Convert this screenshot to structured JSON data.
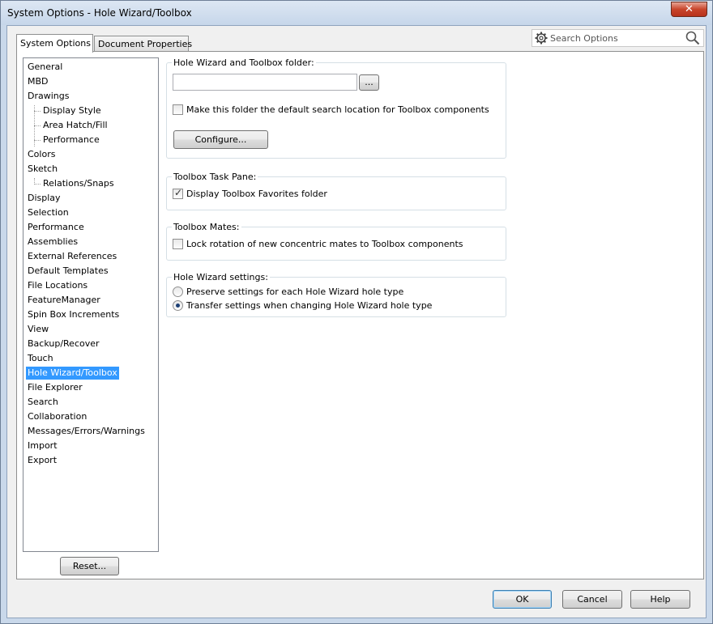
{
  "window": {
    "title": "System Options - Hole Wizard/Toolbox",
    "close_glyph": "✕"
  },
  "tabs": [
    {
      "label": "System Options",
      "active": true
    },
    {
      "label": "Document Properties",
      "active": false
    }
  ],
  "search": {
    "placeholder": "Search Options"
  },
  "tree": {
    "items": [
      {
        "label": "General",
        "level": 0
      },
      {
        "label": "MBD",
        "level": 0
      },
      {
        "label": "Drawings",
        "level": 0
      },
      {
        "label": "Display Style",
        "level": 1
      },
      {
        "label": "Area Hatch/Fill",
        "level": 1
      },
      {
        "label": "Performance",
        "level": 1
      },
      {
        "label": "Colors",
        "level": 0
      },
      {
        "label": "Sketch",
        "level": 0
      },
      {
        "label": "Relations/Snaps",
        "level": 1
      },
      {
        "label": "Display",
        "level": 0
      },
      {
        "label": "Selection",
        "level": 0
      },
      {
        "label": "Performance",
        "level": 0
      },
      {
        "label": "Assemblies",
        "level": 0
      },
      {
        "label": "External References",
        "level": 0
      },
      {
        "label": "Default Templates",
        "level": 0
      },
      {
        "label": "File Locations",
        "level": 0
      },
      {
        "label": "FeatureManager",
        "level": 0
      },
      {
        "label": "Spin Box Increments",
        "level": 0
      },
      {
        "label": "View",
        "level": 0
      },
      {
        "label": "Backup/Recover",
        "level": 0
      },
      {
        "label": "Touch",
        "level": 0
      },
      {
        "label": "Hole Wizard/Toolbox",
        "level": 0,
        "selected": true
      },
      {
        "label": "File Explorer",
        "level": 0
      },
      {
        "label": "Search",
        "level": 0
      },
      {
        "label": "Collaboration",
        "level": 0
      },
      {
        "label": "Messages/Errors/Warnings",
        "level": 0
      },
      {
        "label": "Import",
        "level": 0
      },
      {
        "label": "Export",
        "level": 0
      }
    ]
  },
  "reset_label": "Reset...",
  "folder_group": {
    "title": "Hole Wizard and Toolbox folder:",
    "path_value": "",
    "browse_label": "...",
    "default_location_label": "Make this folder the default search location for Toolbox components",
    "default_location_checked": false,
    "configure_label": "Configure..."
  },
  "task_pane_group": {
    "title": "Toolbox Task Pane:",
    "favorites_label": "Display Toolbox Favorites folder",
    "favorites_checked": true,
    "check_glyph": "✓"
  },
  "mates_group": {
    "title": "Toolbox Mates:",
    "lock_rotation_label": "Lock rotation of new concentric mates to Toolbox components",
    "lock_rotation_checked": false
  },
  "hole_wizard_group": {
    "title": "Hole Wizard settings:",
    "options": [
      {
        "label": "Preserve settings for each Hole Wizard hole type",
        "selected": false
      },
      {
        "label": "Transfer settings when changing Hole Wizard hole type",
        "selected": true
      }
    ]
  },
  "footer": {
    "ok_label": "OK",
    "cancel_label": "Cancel",
    "help_label": "Help"
  }
}
